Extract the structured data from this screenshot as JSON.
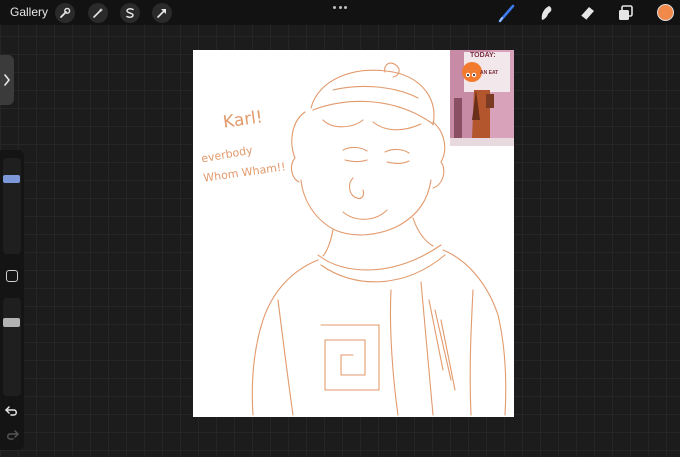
{
  "topbar": {
    "gallery_label": "Gallery",
    "left_tools": [
      "wrench-icon",
      "magic-wand-icon",
      "selection-icon",
      "transform-arrow-icon"
    ],
    "right_tools": [
      "brush-icon",
      "smudge-icon",
      "eraser-icon",
      "layers-icon"
    ],
    "active_tool": "brush",
    "current_color": "#f0894a",
    "active_tool_color": "#3d7bf0"
  },
  "canvas": {
    "background": "#ffffff",
    "sketch_color": "#e29a6c",
    "text_name": "Karl!",
    "text_line1": "everbody",
    "text_line2": "Whom Wham!!"
  },
  "reference_image": {
    "sign_line1": "TODAY:",
    "sign_line2": "AN EAT"
  },
  "sidebar": {
    "brush_size_level": 0.1,
    "opacity_level": 0.7
  }
}
